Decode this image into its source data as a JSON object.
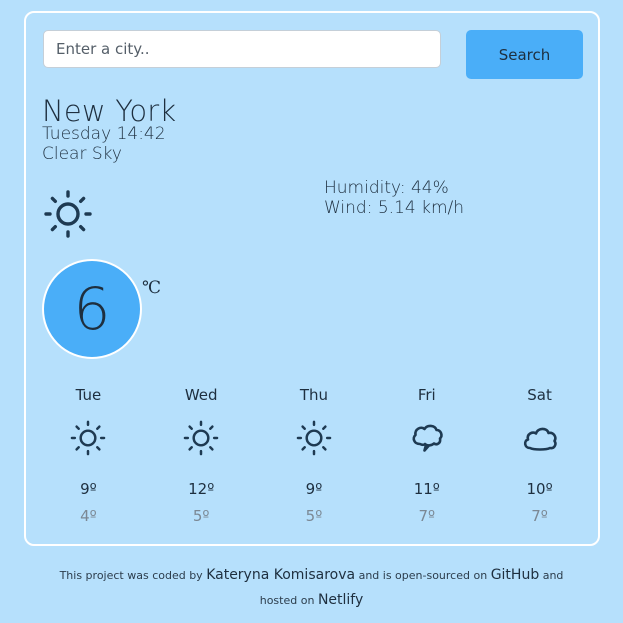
{
  "search": {
    "placeholder": "Enter a city..",
    "button_label": "Search"
  },
  "current": {
    "city": "New York",
    "datetime": "Tuesday 14:42",
    "description": "Clear Sky",
    "humidity": "Humidity: 44%",
    "wind": "Wind: 5.14 km/h",
    "icon": "sun-icon",
    "temperature": "6",
    "unit": "℃"
  },
  "forecast": [
    {
      "day": "Tue",
      "icon": "sun-icon",
      "max": "9º",
      "min": "4º"
    },
    {
      "day": "Wed",
      "icon": "sun-icon",
      "max": "12º",
      "min": "5º"
    },
    {
      "day": "Thu",
      "icon": "sun-icon",
      "max": "9º",
      "min": "5º"
    },
    {
      "day": "Fri",
      "icon": "cloud-icon",
      "max": "11º",
      "min": "7º"
    },
    {
      "day": "Sat",
      "icon": "cloud-icon",
      "max": "10º",
      "min": "7º"
    }
  ],
  "footer": {
    "text1": "This project was coded by ",
    "author": "Kateryna Komisarova",
    "text2": " and is open-sourced on ",
    "github": "GitHub",
    "text3": " and",
    "text4": "hosted on ",
    "netlify": "Netlify"
  },
  "colors": {
    "background": "#b6e0fc",
    "accent": "#4aaef8",
    "text": "#1e2f3f"
  }
}
